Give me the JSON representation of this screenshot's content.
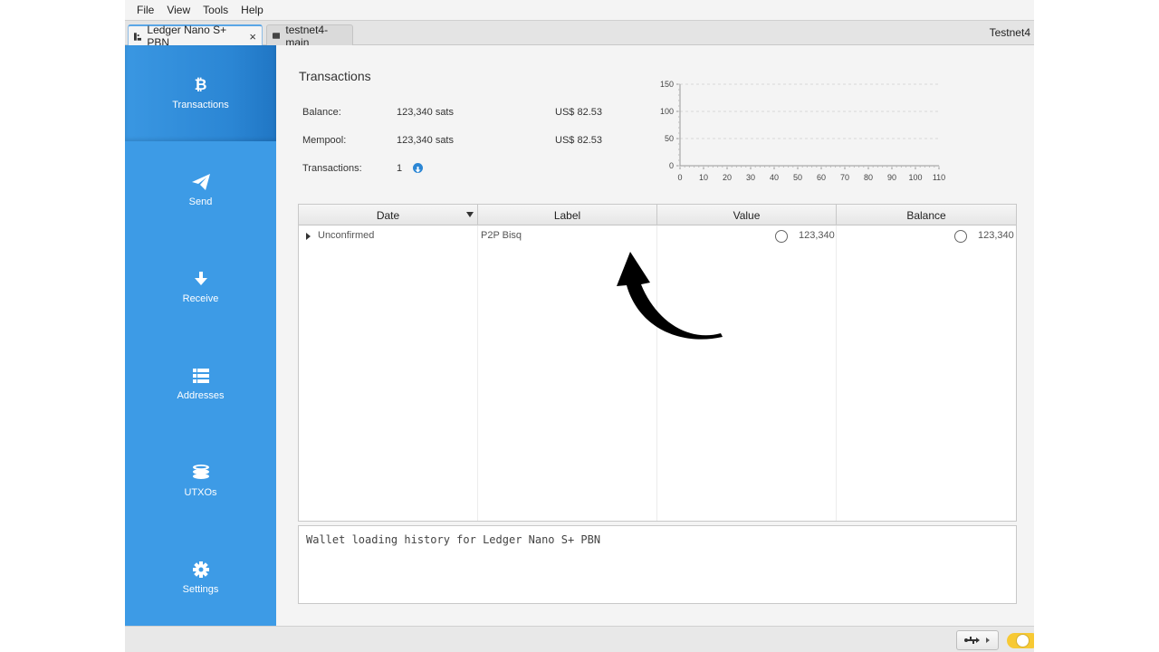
{
  "menu": [
    "File",
    "View",
    "Tools",
    "Help"
  ],
  "tabs": [
    {
      "label": "Ledger Nano S+ PBN",
      "close": "×"
    },
    {
      "label": "testnet4-main"
    }
  ],
  "network": "Testnet4",
  "sidebar": {
    "items": [
      {
        "label": "Transactions",
        "icon": "bitcoin-icon"
      },
      {
        "label": "Send",
        "icon": "paper-plane-icon"
      },
      {
        "label": "Receive",
        "icon": "arrow-down-icon"
      },
      {
        "label": "Addresses",
        "icon": "list-icon"
      },
      {
        "label": "UTXOs",
        "icon": "coins-icon"
      },
      {
        "label": "Settings",
        "icon": "gear-icon"
      }
    ]
  },
  "main": {
    "title": "Transactions",
    "balance": {
      "label": "Balance:",
      "value": "123,340 sats",
      "fiat": "US$ 82.53"
    },
    "mempool": {
      "label": "Mempool:",
      "value": "123,340 sats",
      "fiat": "US$ 82.53"
    },
    "transactions": {
      "label": "Transactions:",
      "value": "1"
    }
  },
  "chart_data": {
    "type": "line",
    "x_ticks": [
      "0",
      "10",
      "20",
      "30",
      "40",
      "50",
      "60",
      "70",
      "80",
      "90",
      "100",
      "110"
    ],
    "y_ticks": [
      "0",
      "50",
      "100",
      "150"
    ],
    "xlim": [
      0,
      110
    ],
    "ylim": [
      0,
      150
    ],
    "grid": true,
    "series": []
  },
  "table": {
    "headers": [
      "Date",
      "Label",
      "Value",
      "Balance"
    ],
    "rows": [
      {
        "date": "Unconfirmed",
        "label": "P2P Bisq",
        "value": "123,340",
        "balance": "123,340"
      }
    ]
  },
  "console": "Wallet loading history for Ledger Nano S+ PBN",
  "status": {
    "toggle_color": "#f7c934"
  }
}
